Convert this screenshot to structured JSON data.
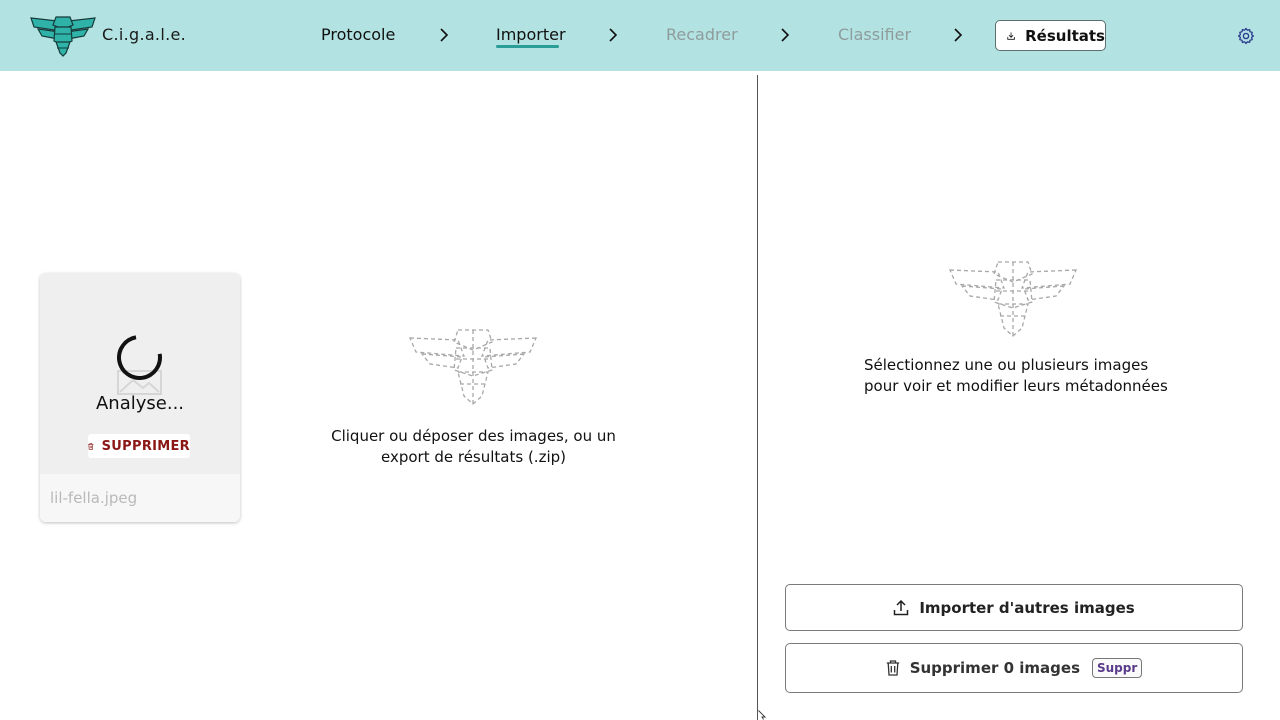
{
  "header": {
    "app_name": "C.i.g.a.l.e.",
    "steps": [
      {
        "label": "Protocole",
        "state": "done"
      },
      {
        "label": "Importer",
        "state": "current"
      },
      {
        "label": "Recadrer",
        "state": "disabled"
      },
      {
        "label": "Classifier",
        "state": "disabled"
      }
    ],
    "results_label": "Résultats",
    "background": "#b2e2e1",
    "accent": "#2a9d96"
  },
  "gallery": {
    "cards": [
      {
        "status": "Analyse...",
        "delete_label": "SUPPRIMER",
        "filename": "lil-fella.jpeg"
      }
    ],
    "dropzone_text": "Cliquer ou déposer des images, ou un export de résultats (.zip)"
  },
  "sidebar": {
    "empty_text": "Sélectionnez une ou plusieurs images pour voir et modifier leurs métadonnées",
    "import_label": "Importer d'autres images",
    "delete_label": "Supprimer 0 images",
    "delete_shortcut": "Suppr"
  },
  "icons": {
    "logo": "cicada-logo-icon",
    "chevron": "chevron-right-icon",
    "download": "download-icon",
    "settings": "gear-icon",
    "trash": "trash-icon",
    "upload": "upload-icon",
    "placeholder": "cicada-outline-icon"
  },
  "colors": {
    "danger": "#8a1616",
    "shortcut": "#5a3a8a"
  }
}
